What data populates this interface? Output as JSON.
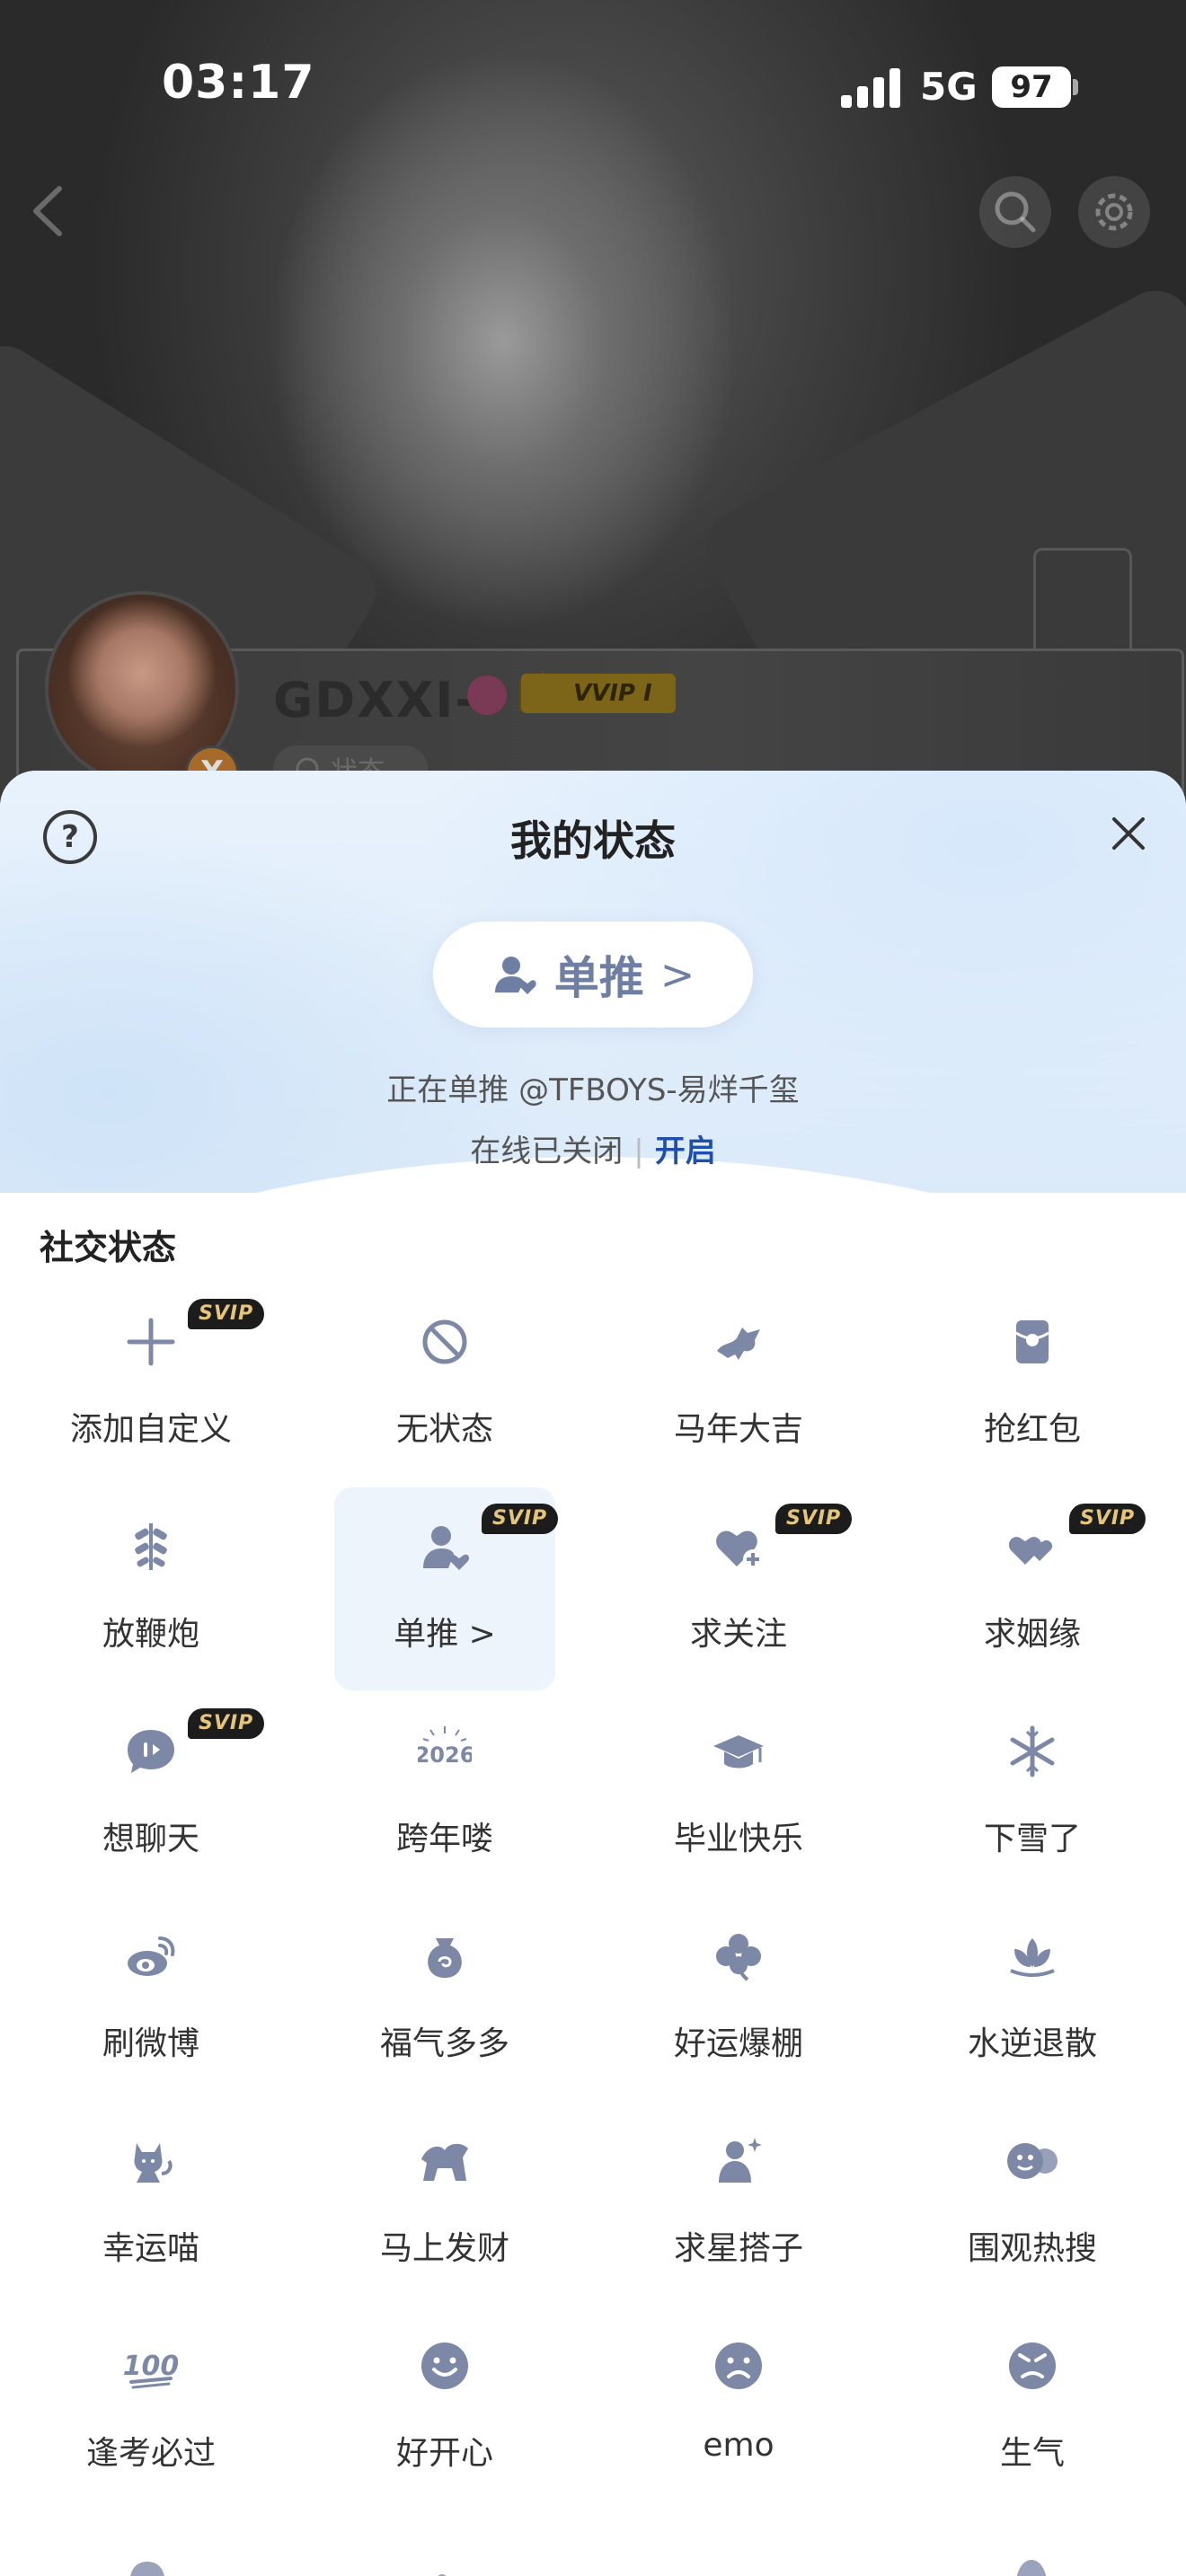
{
  "status_bar": {
    "time": "03:17",
    "network": "5G",
    "battery": "97"
  },
  "profile": {
    "username": "GDXXI-",
    "vip_badge": "VVIP I",
    "avatar_badge": "X",
    "status_chip": "状态"
  },
  "sheet": {
    "title": "我的状态",
    "help_label": "?",
    "close_label": "×",
    "current_status": {
      "label": "单推",
      "chevron": ">"
    },
    "subtitle": "正在单推 @TFBOYS-易烊千玺",
    "online_text": "在线已关闭",
    "online_separator": "|",
    "online_action": "开启",
    "section_title": "社交状态"
  },
  "colors": {
    "accent": "#1f4fa8",
    "icon": "#7d88a6",
    "selected_bg": "#eef4fc",
    "svip_text": "#e4c57a"
  },
  "status_items": [
    {
      "label": "添加自定义",
      "icon": "plus-icon",
      "badge": "SVIP"
    },
    {
      "label": "无状态",
      "icon": "no-status-icon"
    },
    {
      "label": "马年大吉",
      "icon": "horse-icon"
    },
    {
      "label": "抢红包",
      "icon": "red-envelope-icon"
    },
    {
      "label": "放鞭炮",
      "icon": "firecracker-icon"
    },
    {
      "label": "单推 >",
      "icon": "person-heart-icon",
      "badge": "SVIP",
      "selected": true
    },
    {
      "label": "求关注",
      "icon": "heart-plus-icon",
      "badge": "SVIP"
    },
    {
      "label": "求姻缘",
      "icon": "double-heart-icon",
      "badge": "SVIP"
    },
    {
      "label": "想聊天",
      "icon": "chat-bubble-icon",
      "badge": "SVIP"
    },
    {
      "label": "跨年喽",
      "icon": "year-2026-icon",
      "icon_text": "2026"
    },
    {
      "label": "毕业快乐",
      "icon": "graduation-cap-icon"
    },
    {
      "label": "下雪了",
      "icon": "snowflake-icon"
    },
    {
      "label": "刷微博",
      "icon": "weibo-icon"
    },
    {
      "label": "福气多多",
      "icon": "lucky-bag-icon"
    },
    {
      "label": "好运爆棚",
      "icon": "clover-icon"
    },
    {
      "label": "水逆退散",
      "icon": "lotus-icon"
    },
    {
      "label": "幸运喵",
      "icon": "lucky-cat-icon"
    },
    {
      "label": "马上发财",
      "icon": "horse-coin-icon"
    },
    {
      "label": "求星搭子",
      "icon": "star-buddy-icon"
    },
    {
      "label": "围观热搜",
      "icon": "onlooker-faces-icon"
    },
    {
      "label": "逢考必过",
      "icon": "hundred-points-icon",
      "icon_text": "100"
    },
    {
      "label": "好开心",
      "icon": "happy-face-icon"
    },
    {
      "label": "emo",
      "icon": "sad-face-icon"
    },
    {
      "label": "生气",
      "icon": "angry-face-icon"
    }
  ]
}
